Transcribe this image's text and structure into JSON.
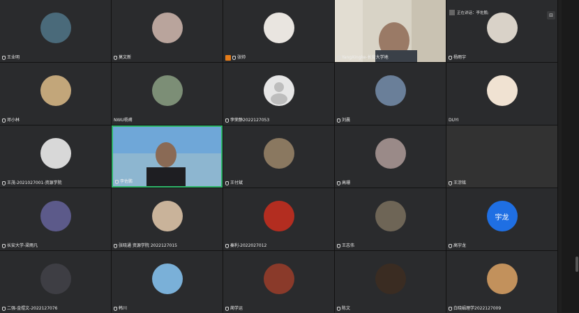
{
  "speaker_notice": "正在讲话：李佐鹏;",
  "layout_button": "⊟",
  "tiles": [
    {
      "name": "王业明",
      "avatar": "#4a6a7a"
    },
    {
      "name": "莫文新",
      "avatar": "#b9a49c"
    },
    {
      "name": "张帅",
      "avatar": "#e9e5e0"
    },
    {
      "name": "YangXingke-长安大学地",
      "avatar": ""
    },
    {
      "name": "杨雨宇",
      "avatar": "#d9d2c8"
    },
    {
      "name": "邓小林",
      "avatar": "#c2a67a"
    },
    {
      "name": "NWU杨甫",
      "avatar": "#7c8e76"
    },
    {
      "name": "李荣静2022127053",
      "avatar": "#e6e6e6"
    },
    {
      "name": "刘晨",
      "avatar": "#6a7f99"
    },
    {
      "name": "DUYI",
      "avatar": "#f0e2d2"
    },
    {
      "name": "王茂-2021027001-资源学院",
      "avatar": "#d8d8d8"
    },
    {
      "name": "李佐鹏",
      "avatar": ""
    },
    {
      "name": "王付斌",
      "avatar": "#8a7860"
    },
    {
      "name": "高珊",
      "avatar": "#9a8a88"
    },
    {
      "name": "王淙铭",
      "avatar": ""
    },
    {
      "name": "长安大学-梁雨凡",
      "avatar": "#5c5a8a"
    },
    {
      "name": "张晓通 资源学院 2022127015",
      "avatar": "#c9b39a"
    },
    {
      "name": "秦利-2022027012",
      "avatar": "#b32d20"
    },
    {
      "name": "王志伟",
      "avatar": "#6e6556"
    },
    {
      "name": "高宇龙",
      "avatar": "#1f6fe3",
      "text": "宇龙"
    },
    {
      "name": "二强-金煜文-2022127076",
      "avatar": "#3e3e44"
    },
    {
      "name": "韩川",
      "avatar": "#7ab0d8"
    },
    {
      "name": "蔺学运",
      "avatar": "#8a3a2a"
    },
    {
      "name": "陈文",
      "avatar": "#3a2c22"
    },
    {
      "name": "白晓娟理学2022127009",
      "avatar": "#c2915c"
    }
  ]
}
